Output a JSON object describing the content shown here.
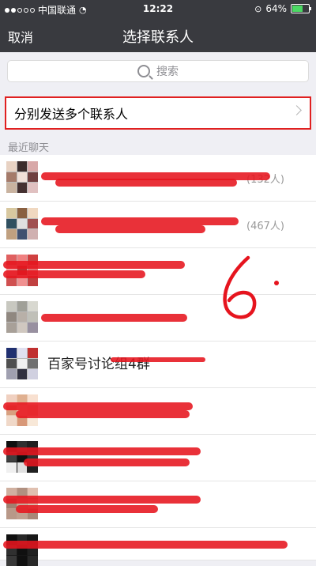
{
  "status_bar": {
    "carrier": "中国联通",
    "time": "12:22",
    "battery_percent": 64,
    "battery_label": "64%"
  },
  "nav": {
    "cancel_label": "取消",
    "title": "选择联系人"
  },
  "search": {
    "placeholder": "搜索"
  },
  "multi_send": {
    "label": "分别发送多个联系人"
  },
  "section": {
    "recent_chats_label": "最近聊天"
  },
  "chats": [
    {
      "name": "",
      "count": "(132人)"
    },
    {
      "name": "",
      "count": "(467人)"
    },
    {
      "name": "",
      "count": ""
    },
    {
      "name": "",
      "count": ""
    },
    {
      "name": "百家号讨论组4群",
      "count": ""
    },
    {
      "name": "",
      "count": ""
    },
    {
      "name": "",
      "count": ""
    },
    {
      "name": "",
      "count": ""
    },
    {
      "name": "",
      "count": ""
    }
  ],
  "annotation": {
    "text": "6"
  },
  "colors": {
    "nav_background": "#393a3f",
    "highlight_border": "#e02020",
    "scribble": "#e6141e",
    "battery_fill": "#4cd964"
  }
}
